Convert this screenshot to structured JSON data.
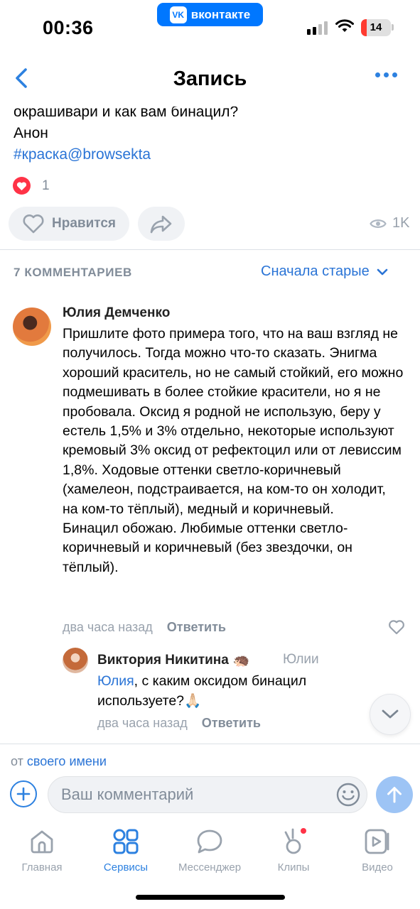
{
  "status_bar": {
    "time": "00:36",
    "app_badge": "вконтакте",
    "app_badge_logo": "VK",
    "battery": "14"
  },
  "header": {
    "title": "Запись"
  },
  "post": {
    "text_cut": "окрашивари и как вам бинацил?",
    "author_line": "Анон",
    "hashtag": "#краска@browsekta",
    "like_count": "1",
    "like_button": "Нравится",
    "views": "1K"
  },
  "comments": {
    "count_label": "7 КОММЕНТАРИЕВ",
    "sort_label": "Сначала старые",
    "items": [
      {
        "author": "Юлия Демченко",
        "text": "Пришлите фото примера того, что на ваш взгляд не получилось. Тогда можно что-то сказать. Энигма хороший краситель, но не самый стойкий, его можно подмешивать в более стойкие красители, но я не пробовала. Оксид я родной не использую, беру у естель 1,5% и 3% отдельно, некоторые используют кремовый 3% оксид от рефектоцил или от левиссим 1,8%. Ходовые оттенки светло-коричневый (хамелеон, подстраивается, на ком-то он холодит, на ком-то тёплый), медный и коричневый.\nБинацил обожаю. Любимые оттенки светло-коричневый и коричневый (без звездочки, он тёплый).",
        "time": "два часа назад",
        "reply_label": "Ответить"
      }
    ],
    "reply": {
      "author": "Виктория Никитина",
      "author_emoji": "🦔",
      "reply_to": "Юлии",
      "mention": "Юлия",
      "text": ", с каким оксидом бинацил используете?🙏🏻",
      "time": "два часа назад",
      "reply_label": "Ответить"
    }
  },
  "composer": {
    "from_prefix": "от",
    "from_name": "своего имени",
    "placeholder": "Ваш комментарий"
  },
  "tabbar": {
    "tabs": [
      {
        "label": "Главная",
        "icon": "home-icon",
        "active": false
      },
      {
        "label": "Сервисы",
        "icon": "services-icon",
        "active": true
      },
      {
        "label": "Мессенджер",
        "icon": "messenger-icon",
        "active": false
      },
      {
        "label": "Клипы",
        "icon": "clips-icon",
        "active": false
      },
      {
        "label": "Видео",
        "icon": "video-icon",
        "active": false
      }
    ]
  },
  "colors": {
    "accent": "#2d81e0",
    "link": "#2a74d6",
    "like_red": "#ff3347",
    "secondary_text": "#818c99"
  }
}
